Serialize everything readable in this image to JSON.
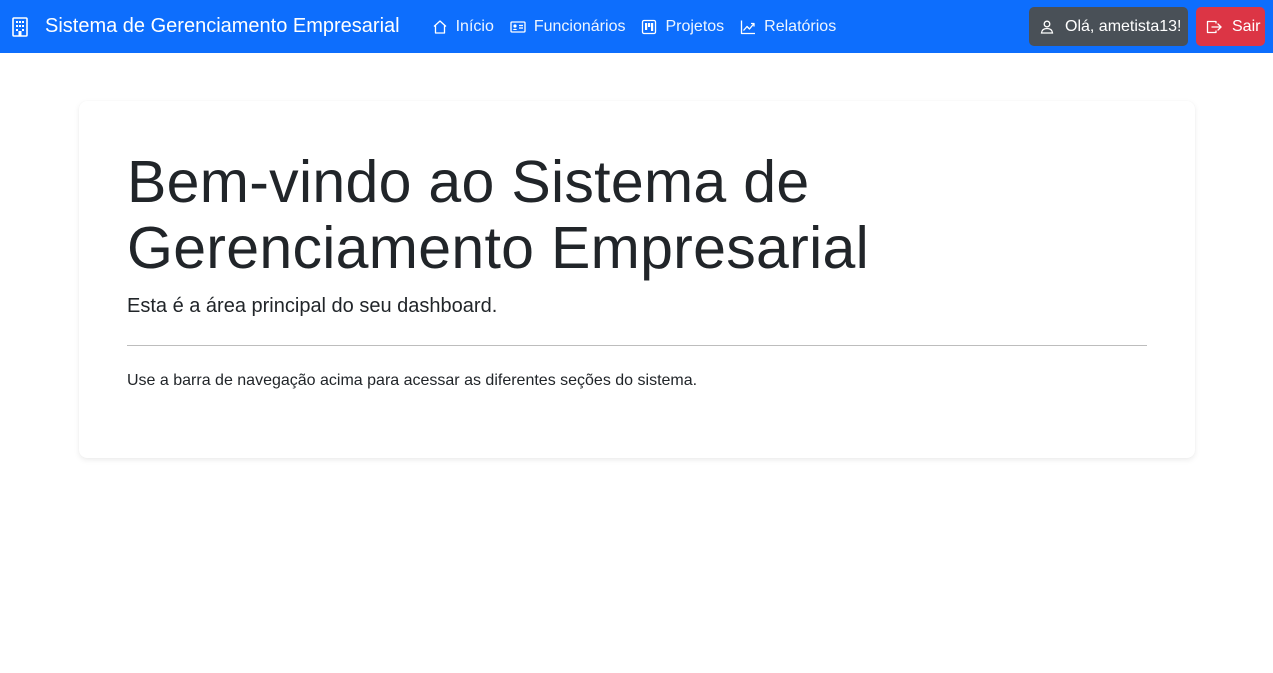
{
  "app": {
    "brand_title": "Sistema de Gerenciamento Empresarial",
    "brand_icon": "building-icon"
  },
  "nav": {
    "items": [
      {
        "label": "Início",
        "icon": "house-icon"
      },
      {
        "label": "Funcionários",
        "icon": "id-card-icon"
      },
      {
        "label": "Projetos",
        "icon": "kanban-icon"
      },
      {
        "label": "Relatórios",
        "icon": "graph-up-icon"
      }
    ],
    "user_button": {
      "label": "Olá, ametista13!",
      "icon": "person-icon"
    },
    "logout_button": {
      "label": "Sair",
      "icon": "box-arrow-right-icon"
    }
  },
  "main": {
    "title": "Bem-vindo ao Sistema de Gerenciamento Empresarial",
    "lead": "Esta é a área principal do seu dashboard.",
    "text": "Use a barra de navegação acima para acessar as diferentes seções do sistema."
  },
  "colors": {
    "navbar": "#0d6efd",
    "user_button": "#495057",
    "logout_button": "#dc3545"
  }
}
